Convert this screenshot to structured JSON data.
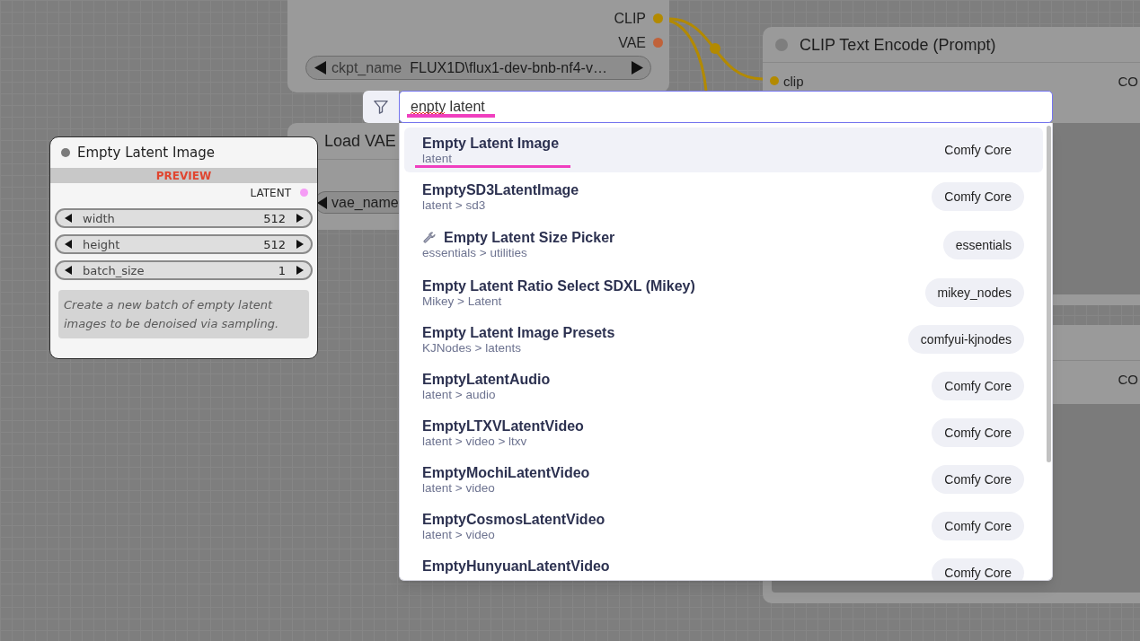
{
  "canvas": {
    "checkpoint_node": {
      "outputs": [
        {
          "label": "CLIP",
          "color": "#b38a00"
        },
        {
          "label": "VAE",
          "color": "#c0623a"
        }
      ],
      "widgets": [
        {
          "name": "ckpt_name",
          "value": "FLUX1D\\flux1-dev-bnb-nf4-v…"
        }
      ]
    },
    "load_vae_node": {
      "title": "Load VAE",
      "widgets": [
        {
          "name": "vae_name"
        }
      ]
    },
    "text_encode_nodes": [
      {
        "title": "CLIP Text Encode (Prompt)",
        "inputs": [
          {
            "label": "clip",
            "color": "#b38a00"
          }
        ],
        "outputs": [
          {
            "label": "CO"
          }
        ]
      },
      {
        "outputs": [
          {
            "label": "CO"
          }
        ]
      }
    ]
  },
  "preview_node": {
    "title": "Empty Latent Image",
    "banner": "PREVIEW",
    "outputs": [
      {
        "label": "LATENT",
        "color": "#f59cf5"
      }
    ],
    "widgets": [
      {
        "name": "width",
        "value": "512"
      },
      {
        "name": "height",
        "value": "512"
      },
      {
        "name": "batch_size",
        "value": "1"
      }
    ],
    "description": "Create a new batch of empty latent images to be denoised via sampling."
  },
  "search": {
    "value": "enpty latent",
    "misspelled": true,
    "marked": true
  },
  "results": [
    {
      "name": "Empty Latent Image",
      "category": "latent",
      "source": "Comfy Core",
      "selected": true,
      "has_icon": false,
      "marked": true
    },
    {
      "name": "EmptySD3LatentImage",
      "category": "latent > sd3",
      "source": "Comfy Core",
      "selected": false,
      "has_icon": false,
      "marked": false
    },
    {
      "name": "Empty Latent Size Picker",
      "category": "essentials > utilities",
      "source": "essentials",
      "selected": false,
      "has_icon": true,
      "marked": false
    },
    {
      "name": "Empty Latent Ratio Select SDXL (Mikey)",
      "category": "Mikey > Latent",
      "source": "mikey_nodes",
      "selected": false,
      "has_icon": false,
      "marked": false
    },
    {
      "name": "Empty Latent Image Presets",
      "category": "KJNodes > latents",
      "source": "comfyui-kjnodes",
      "selected": false,
      "has_icon": false,
      "marked": false
    },
    {
      "name": "EmptyLatentAudio",
      "category": "latent > audio",
      "source": "Comfy Core",
      "selected": false,
      "has_icon": false,
      "marked": false
    },
    {
      "name": "EmptyLTXVLatentVideo",
      "category": "latent > video > ltxv",
      "source": "Comfy Core",
      "selected": false,
      "has_icon": false,
      "marked": false
    },
    {
      "name": "EmptyMochiLatentVideo",
      "category": "latent > video",
      "source": "Comfy Core",
      "selected": false,
      "has_icon": false,
      "marked": false
    },
    {
      "name": "EmptyCosmosLatentVideo",
      "category": "latent > video",
      "source": "Comfy Core",
      "selected": false,
      "has_icon": false,
      "marked": false
    },
    {
      "name": "EmptyHunyuanLatentVideo",
      "source": "Comfy Core",
      "selected": false,
      "has_icon": false,
      "marked": false
    }
  ]
}
